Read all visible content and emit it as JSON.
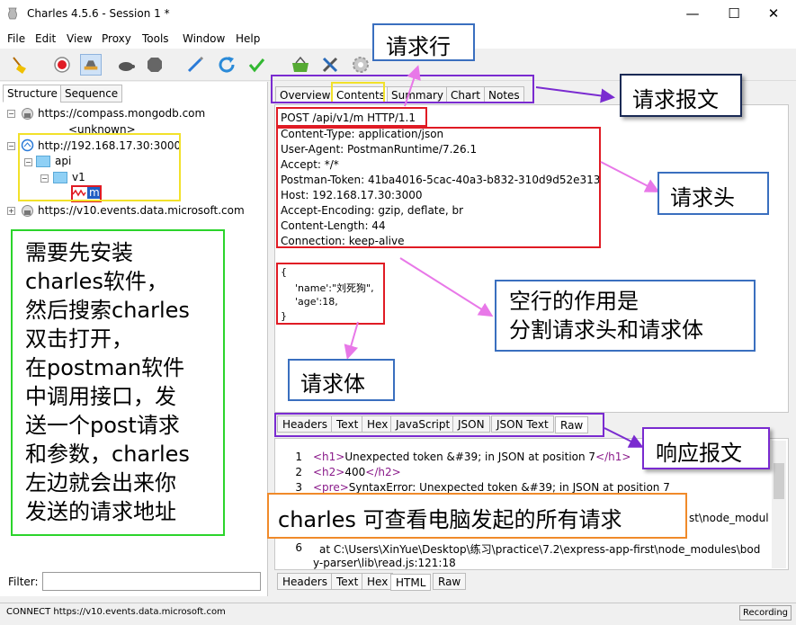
{
  "window": {
    "title": "Charles 4.5.6 - Session 1 *",
    "minimize": "—",
    "maximize": "☐",
    "close": "✕"
  },
  "menu": [
    "File",
    "Edit",
    "View",
    "Proxy",
    "Tools",
    "Window",
    "Help"
  ],
  "left_tabs": {
    "structure": "Structure",
    "sequence": "Sequence"
  },
  "tree": {
    "host1": "https://compass.mongodb.com",
    "host1_child": "<unknown>",
    "host2": "http://192.168.17.30:3000",
    "folder_api": "api",
    "folder_v1": "v1",
    "file_m": "m",
    "host3": "https://v10.events.data.microsoft.com"
  },
  "filter_label": "Filter:",
  "top_tabs": [
    "Overview",
    "Contents",
    "Summary",
    "Chart",
    "Notes"
  ],
  "request": {
    "request_line": "POST /api/v1/m HTTP/1.1",
    "headers": [
      "Content-Type: application/json",
      "User-Agent: PostmanRuntime/7.26.1",
      "Accept: */*",
      "Postman-Token: 41ba4016-5cac-40a3-b832-310d9d52e313",
      "Host: 192.168.17.30:3000",
      "Accept-Encoding: gzip, deflate, br",
      "Content-Length: 44",
      "Connection: keep-alive"
    ],
    "body": [
      "{",
      "'name':\"刘死狗\",",
      "'age':18,",
      "}"
    ]
  },
  "request_subtabs": [
    "Headers",
    "Text",
    "Hex",
    "JavaScript",
    "JSON",
    "JSON Text",
    "Raw"
  ],
  "response": {
    "line_numbers": [
      "1",
      "2",
      "3",
      "",
      "",
      "6",
      ""
    ],
    "lines": [
      {
        "open": "<h1>",
        "text": "Unexpected token &#39; in JSON at position 7",
        "close": "</h1>"
      },
      {
        "open": "<h2>",
        "text": "400",
        "close": "</h2>"
      },
      {
        "open": "<pre>",
        "text": "SyntaxError: Unexpected token &#39; in JSON at position 7",
        "close": ""
      },
      {
        "open": "",
        "text": "st\\node_modul",
        "close": ""
      },
      {
        "open": "",
        "text": "",
        "close": ""
      },
      {
        "open": "",
        "text": "   at C:\\Users\\XinYue\\Desktop\\练习\\practice\\7.2\\express-app-first\\node_modules\\bod",
        "close": ""
      },
      {
        "open": "",
        "text": "y-parser\\lib\\read.js:121:18",
        "close": ""
      }
    ]
  },
  "response_subtabs": [
    "Headers",
    "Text",
    "Hex",
    "HTML",
    "Raw"
  ],
  "status": {
    "text": "CONNECT https://v10.events.data.microsoft.com",
    "recording": "Recording"
  },
  "annotations": {
    "request_line_label": "请求行",
    "request_message_label": "请求报文",
    "request_header_label": "请求头",
    "blank_line_note": "空行的作用是\n分割请求头和请求体",
    "request_body_label": "请求体",
    "response_message_label": "响应报文",
    "green_note": "需要先安装\ncharles软件，\n然后搜索charles\n双击打开，\n在postman软件\n中调用接口，发\n送一个post请求\n和参数，charles\n左边就会出来你\n发送的请求地址",
    "orange_note": "charles 可查看电脑发起的所有请求"
  },
  "colors": {
    "red_box": "#e01b24",
    "yellow_box": "#f2e12a",
    "purple_box": "#7a2bd0",
    "green_box": "#2bd42b",
    "orange_box": "#f08a2a",
    "callout_border": "#3a6fbf",
    "arrow": "#e878e8"
  }
}
